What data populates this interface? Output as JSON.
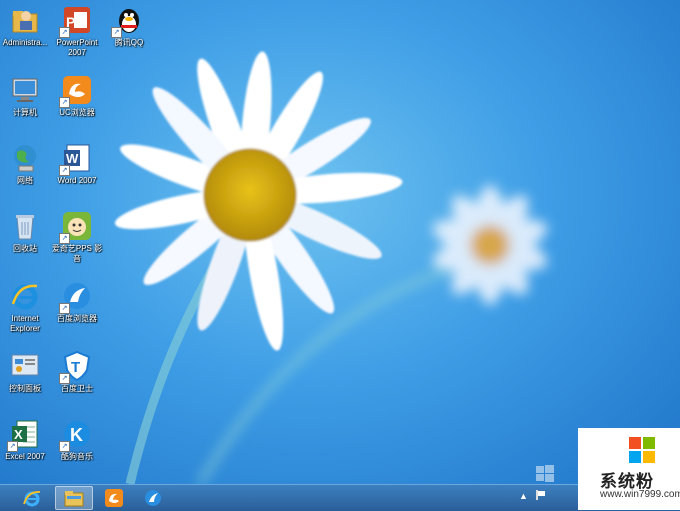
{
  "desktop": {
    "icons": [
      {
        "label": "Administra...",
        "icon": "user-folder-icon"
      },
      {
        "label": "PowerPoint 2007",
        "icon": "powerpoint-icon"
      },
      {
        "label": "腾讯QQ",
        "icon": "qq-penguin-icon"
      },
      {
        "label": "计算机",
        "icon": "computer-icon"
      },
      {
        "label": "UC浏览器",
        "icon": "uc-browser-icon"
      },
      {
        "label": "网络",
        "icon": "network-globe-icon"
      },
      {
        "label": "Word 2007",
        "icon": "word-icon"
      },
      {
        "label": "回收站",
        "icon": "recycle-bin-icon"
      },
      {
        "label": "爱奇艺PPS 影音",
        "icon": "iqiyi-pps-icon"
      },
      {
        "label": "Internet Explorer",
        "icon": "internet-explorer-icon"
      },
      {
        "label": "百度浏览器",
        "icon": "baidu-browser-icon"
      },
      {
        "label": "控制面板",
        "icon": "control-panel-icon"
      },
      {
        "label": "百度卫士",
        "icon": "baidu-guard-icon"
      },
      {
        "label": "Excel 2007",
        "icon": "excel-icon"
      },
      {
        "label": "酷狗音乐",
        "icon": "kugou-music-icon"
      }
    ]
  },
  "taskbar": {
    "pinned": [
      "internet-explorer-icon",
      "file-explorer-icon",
      "uc-browser-icon",
      "baidu-browser-icon"
    ]
  },
  "watermark": {
    "title": "系统粉",
    "url": "www.win7999.com",
    "logo_colors": [
      "#f25022",
      "#7fba00",
      "#00a4ef",
      "#ffb900"
    ]
  }
}
